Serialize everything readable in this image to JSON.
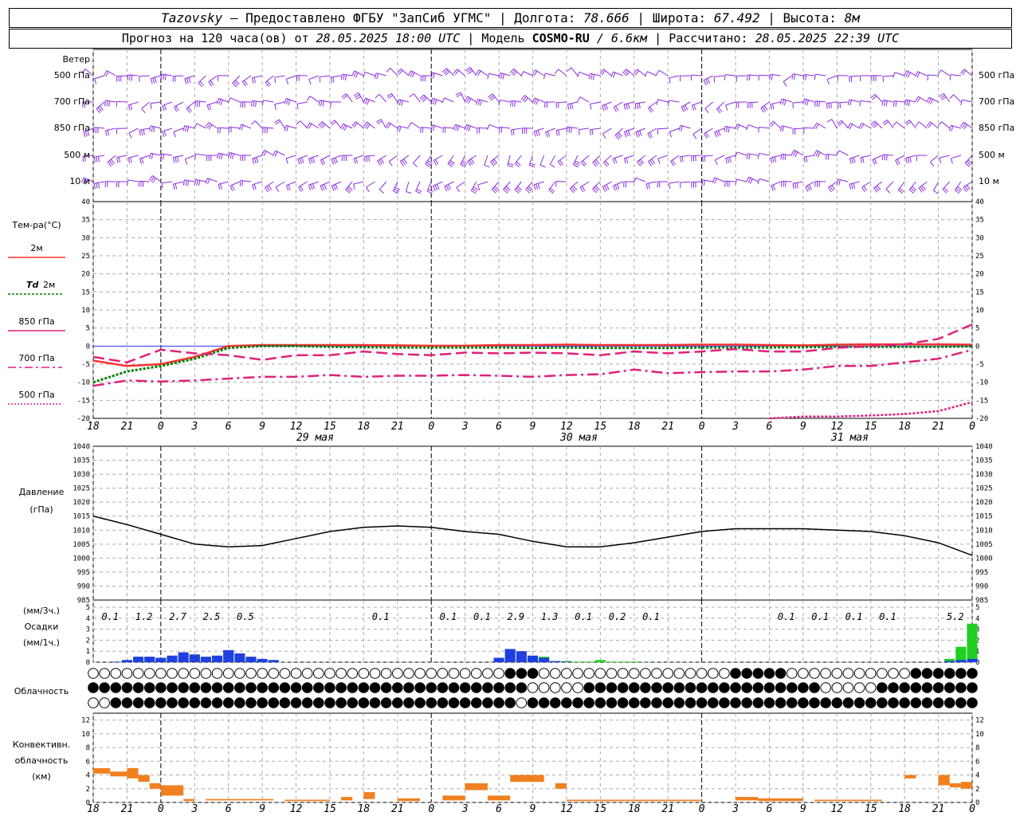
{
  "header": {
    "station": "Tazovsky",
    "provider": "— Предоставлено ФГБУ \"ЗапСиб УГМС\"",
    "lon_label": "Долгота:",
    "lon": "78.666",
    "lat_label": "Широта:",
    "lat": "67.492",
    "alt_label": "Высота:",
    "alt": "8м",
    "forecast_label": "Прогноз на 120 часа(ов) от",
    "forecast_time": "28.05.2025 18:00 UTC",
    "model_label": "Модель",
    "model": "COSMO-RU",
    "model_res": "/ 6.6км",
    "calc_label": "Рассчитано:",
    "calc_time": "28.05.2025 22:39 UTC"
  },
  "labels": {
    "wind": "Ветер",
    "levels": [
      "500 гПа",
      "700 гПа",
      "850 гПа",
      "500 м",
      "10  м"
    ],
    "temp": "Тем-ра(°C)",
    "t2m": "2м",
    "td": "Td",
    "td2m": "2м",
    "t850": "850 гПа",
    "t700": "700 гПа",
    "t500": "500 гПа",
    "pressure1": "Давление",
    "pressure2": "(гПа)",
    "precip1": "(мм/3ч.)",
    "precip2": "Осадки",
    "precip3": "(мм/1ч.)",
    "cloud": "Облачность",
    "conv1": "Конвективн.",
    "conv2": "облачность",
    "conv3": "(км)",
    "days": [
      "29 мая",
      "30 мая",
      "31 мая"
    ]
  },
  "colors": {
    "t2m": "#ff3030",
    "td": "#008000",
    "t850": "#e0207a",
    "t700": "#e0207a",
    "t500": "#e0207a",
    "wind": "#8a2be2",
    "precip_blue": "#1e40e0",
    "precip_green": "#20d020",
    "conv": "#f08020",
    "zero_line": "#3030ff"
  },
  "chart_data": [
    {
      "type": "line",
      "name": "temperature",
      "x_ticks": [
        "18",
        "21",
        "0",
        "3",
        "6",
        "9",
        "12",
        "15",
        "18",
        "21",
        "0",
        "3",
        "6",
        "9",
        "12",
        "15",
        "18",
        "21",
        "0",
        "3",
        "6",
        "9",
        "12",
        "15",
        "18",
        "21",
        "0"
      ],
      "ylim": [
        -20,
        40
      ],
      "yticks": [
        -20,
        -15,
        -10,
        -5,
        0,
        5,
        10,
        15,
        20,
        25,
        30,
        35,
        40
      ],
      "x": [
        0,
        3,
        6,
        9,
        12,
        15,
        18,
        21,
        24,
        27,
        30,
        33,
        36,
        39,
        42,
        45,
        48,
        51,
        54,
        57,
        60,
        63,
        66,
        69,
        72,
        75,
        78
      ],
      "series": [
        {
          "name": "2м",
          "values": [
            -4,
            -5.5,
            -5,
            -3,
            0,
            0.3,
            0.3,
            0.3,
            0.3,
            0.2,
            0.1,
            0.1,
            0.3,
            0.3,
            0.4,
            0.3,
            0.3,
            0.3,
            0.4,
            0.4,
            0.3,
            0.2,
            0.4,
            0.5,
            0.5,
            0.5,
            0.4
          ]
        },
        {
          "name": "Td 2м",
          "values": [
            -10,
            -7,
            -5.5,
            -3.5,
            -0.5,
            0,
            0,
            -0.2,
            -0.3,
            -0.4,
            -0.4,
            -0.4,
            -0.4,
            -0.5,
            -0.4,
            -0.5,
            -0.5,
            -0.5,
            -0.4,
            -0.4,
            -0.4,
            -0.3,
            -0.2,
            -0.2,
            -0.2,
            -0.2,
            -0.1
          ]
        },
        {
          "name": "850 гПа",
          "values": [
            -3,
            -4.5,
            -1,
            -2,
            -2.5,
            -3.8,
            -2.5,
            -2.5,
            -1.5,
            -2.2,
            -2.5,
            -1.8,
            -2,
            -1.8,
            -2,
            -2.5,
            -1.5,
            -2,
            -1.5,
            -0.8,
            -1.5,
            -1.5,
            -0.5,
            0,
            0.5,
            2,
            6
          ]
        },
        {
          "name": "700 гПа",
          "values": [
            -11,
            -9.5,
            -9.8,
            -9.5,
            -9,
            -8.5,
            -8.5,
            -8,
            -8.5,
            -8.2,
            -8.2,
            -8,
            -8.2,
            -8.5,
            -8,
            -7.8,
            -6.5,
            -7.5,
            -7.2,
            -7,
            -7,
            -6.5,
            -5.5,
            -5.5,
            -4.5,
            -3.5,
            -1
          ]
        },
        {
          "name": "500 гПа",
          "x": [
            60,
            63,
            66,
            69,
            72,
            75,
            78
          ],
          "values": [
            -20,
            -19.5,
            -19.5,
            -19.2,
            -18.8,
            -18,
            -15.5
          ]
        }
      ]
    },
    {
      "type": "line",
      "name": "pressure",
      "ylim": [
        985,
        1040
      ],
      "yticks": [
        985,
        990,
        995,
        1000,
        1005,
        1010,
        1015,
        1020,
        1025,
        1030,
        1035,
        1040
      ],
      "x": [
        0,
        3,
        6,
        9,
        12,
        15,
        18,
        21,
        24,
        27,
        30,
        33,
        36,
        39,
        42,
        45,
        48,
        51,
        54,
        57,
        60,
        63,
        66,
        69,
        72,
        75,
        78
      ],
      "values": [
        1015,
        1012,
        1008.5,
        1005,
        1004,
        1004.5,
        1007,
        1009.5,
        1011,
        1011.5,
        1011,
        1009.5,
        1008.5,
        1006,
        1004,
        1004,
        1005.5,
        1007.5,
        1009.5,
        1010.5,
        1010.5,
        1010.5,
        1010,
        1009.5,
        1008,
        1005.5,
        1001
      ]
    },
    {
      "type": "bar",
      "name": "precipitation",
      "ylim": [
        0,
        5
      ],
      "labels_3h": [
        {
          "x": 1.5,
          "text": "0.1"
        },
        {
          "x": 4.5,
          "text": "1.2"
        },
        {
          "x": 7.5,
          "text": "2.7"
        },
        {
          "x": 10.5,
          "text": "2.5"
        },
        {
          "x": 13.5,
          "text": "0.5"
        },
        {
          "x": 25.5,
          "text": "0.1"
        },
        {
          "x": 31.5,
          "text": "0.1"
        },
        {
          "x": 34.5,
          "text": "0.1"
        },
        {
          "x": 37.5,
          "text": "2.9"
        },
        {
          "x": 40.5,
          "text": "1.3"
        },
        {
          "x": 43.5,
          "text": "0.1"
        },
        {
          "x": 46.5,
          "text": "0.2"
        },
        {
          "x": 49.5,
          "text": "0.1"
        },
        {
          "x": 61.5,
          "text": "0.1"
        },
        {
          "x": 64.5,
          "text": "0.1"
        },
        {
          "x": 67.5,
          "text": "0.1"
        },
        {
          "x": 70.5,
          "text": "0.1"
        },
        {
          "x": 76.5,
          "text": "5.2"
        }
      ],
      "hourly_blue": [
        0,
        0,
        0.05,
        0.2,
        0.5,
        0.5,
        0.4,
        0.6,
        0.9,
        0.7,
        0.5,
        0.6,
        1.1,
        0.8,
        0.5,
        0.3,
        0.2,
        0,
        0,
        0,
        0,
        0,
        0,
        0,
        0,
        0,
        0,
        0,
        0,
        0,
        0,
        0,
        0,
        0,
        0,
        0,
        0.4,
        1.2,
        1.0,
        0.6,
        0.4,
        0.1,
        0.05,
        0,
        0,
        0,
        0,
        0,
        0,
        0,
        0,
        0,
        0,
        0,
        0,
        0,
        0,
        0,
        0,
        0,
        0,
        0,
        0,
        0,
        0,
        0,
        0,
        0,
        0,
        0,
        0,
        0,
        0,
        0,
        0,
        0,
        0.1,
        0.2,
        0.3
      ],
      "hourly_green": [
        0,
        0,
        0,
        0,
        0,
        0,
        0,
        0,
        0.1,
        0.7,
        0.3,
        0.1,
        0,
        0,
        0,
        0,
        0,
        0,
        0,
        0,
        0,
        0,
        0,
        0,
        0,
        0,
        0,
        0,
        0,
        0,
        0,
        0,
        0,
        0,
        0,
        0,
        0,
        0.1,
        0.3,
        0.3,
        0.5,
        0.1,
        0.1,
        0.05,
        0.05,
        0.2,
        0.05,
        0.05,
        0.05,
        0.02,
        0,
        0,
        0,
        0,
        0,
        0,
        0,
        0,
        0,
        0,
        0,
        0,
        0,
        0,
        0,
        0,
        0,
        0,
        0,
        0,
        0,
        0,
        0,
        0,
        0,
        0,
        0.3,
        1.4,
        3.5
      ]
    },
    {
      "type": "bar",
      "name": "convective_cloud",
      "ylim": [
        0,
        13
      ],
      "yticks": [
        0,
        2,
        4,
        6,
        8,
        10,
        12
      ],
      "segments": [
        {
          "x0": 0,
          "x1": 1.5,
          "top": 5,
          "bottom": 4.2
        },
        {
          "x0": 1.5,
          "x1": 3,
          "top": 4.5,
          "bottom": 3.8
        },
        {
          "x0": 3,
          "x1": 4,
          "top": 5,
          "bottom": 3.5
        },
        {
          "x0": 4,
          "x1": 5,
          "top": 4,
          "bottom": 3
        },
        {
          "x0": 5,
          "x1": 6,
          "top": 2.8,
          "bottom": 2
        },
        {
          "x0": 6,
          "x1": 8,
          "top": 2.5,
          "bottom": 1
        },
        {
          "x0": 8,
          "x1": 9,
          "top": 0.5,
          "bottom": 0.2
        },
        {
          "x0": 10,
          "x1": 16,
          "top": 0.5,
          "bottom": 0.3
        },
        {
          "x0": 17,
          "x1": 21,
          "top": 0.4,
          "bottom": 0.2
        },
        {
          "x0": 22,
          "x1": 23,
          "top": 0.8,
          "bottom": 0.3
        },
        {
          "x0": 24,
          "x1": 25,
          "top": 1.5,
          "bottom": 0.5
        },
        {
          "x0": 27,
          "x1": 29,
          "top": 0.6,
          "bottom": 0.2
        },
        {
          "x0": 31,
          "x1": 33,
          "top": 1,
          "bottom": 0.3
        },
        {
          "x0": 33,
          "x1": 35,
          "top": 2.8,
          "bottom": 1.8
        },
        {
          "x0": 35,
          "x1": 37,
          "top": 1,
          "bottom": 0.3
        },
        {
          "x0": 37,
          "x1": 40,
          "top": 4,
          "bottom": 3
        },
        {
          "x0": 41,
          "x1": 42,
          "top": 2.8,
          "bottom": 2
        },
        {
          "x0": 42,
          "x1": 54,
          "top": 0.4,
          "bottom": 0.2
        },
        {
          "x0": 57,
          "x1": 59,
          "top": 0.8,
          "bottom": 0.3
        },
        {
          "x0": 59,
          "x1": 63,
          "top": 0.6,
          "bottom": 0.2
        },
        {
          "x0": 64,
          "x1": 70,
          "top": 0.4,
          "bottom": 0.2
        },
        {
          "x0": 72,
          "x1": 73,
          "top": 4,
          "bottom": 3.5
        },
        {
          "x0": 75,
          "x1": 76,
          "top": 4,
          "bottom": 2.5
        },
        {
          "x0": 76,
          "x1": 77,
          "top": 2.8,
          "bottom": 2.2
        },
        {
          "x0": 77,
          "x1": 78,
          "top": 3,
          "bottom": 2
        }
      ]
    }
  ]
}
